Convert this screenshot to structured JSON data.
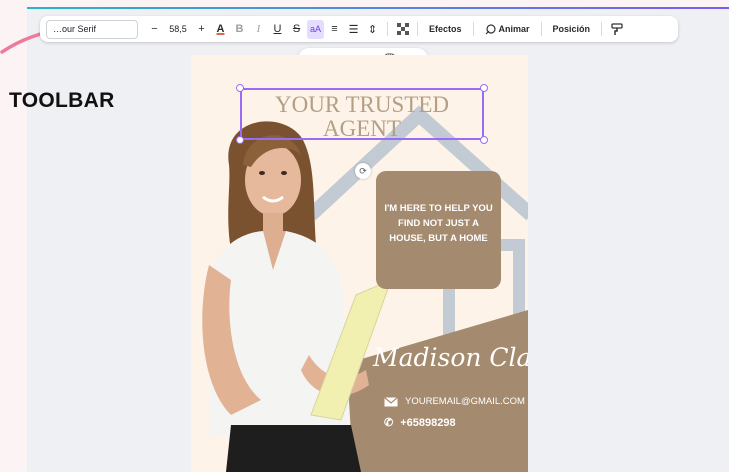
{
  "toolbar": {
    "font_name": "Lexend Tera Serif",
    "font_display": "…our Serif",
    "minus": "−",
    "font_size": "58,5",
    "plus": "+",
    "text_color": "A",
    "bold": "B",
    "italic": "I",
    "underline": "U",
    "strikethrough": "S",
    "case": "aA",
    "align": "≡",
    "list": "☰",
    "spacing": "⇕",
    "effects": "Efectos",
    "animate": "Animar",
    "position": "Posición"
  },
  "annotation": {
    "label": "TOOLBAR",
    "arrow_color": "#ef7a9a"
  },
  "mini_toolbar": {
    "icons": [
      "magic-edit-icon",
      "rotate-icon",
      "lock-icon",
      "duplicate-icon",
      "delete-icon",
      "more-icon"
    ]
  },
  "design": {
    "headline_line1": "YOUR TRUSTED",
    "headline_line2": "AGENT",
    "message": "I'M HERE TO HELP YOU FIND NOT JUST A HOUSE, BUT A HOME",
    "signature": "Madison Clark",
    "email": "YOUREMAIL@GMAIL.COM",
    "phone": "+65898298"
  },
  "colors": {
    "accent": "#9a6cf5",
    "brown": "#a48a6f",
    "canvas_bg": "#fdf3e8",
    "house_lines": "#b8c2cc"
  }
}
